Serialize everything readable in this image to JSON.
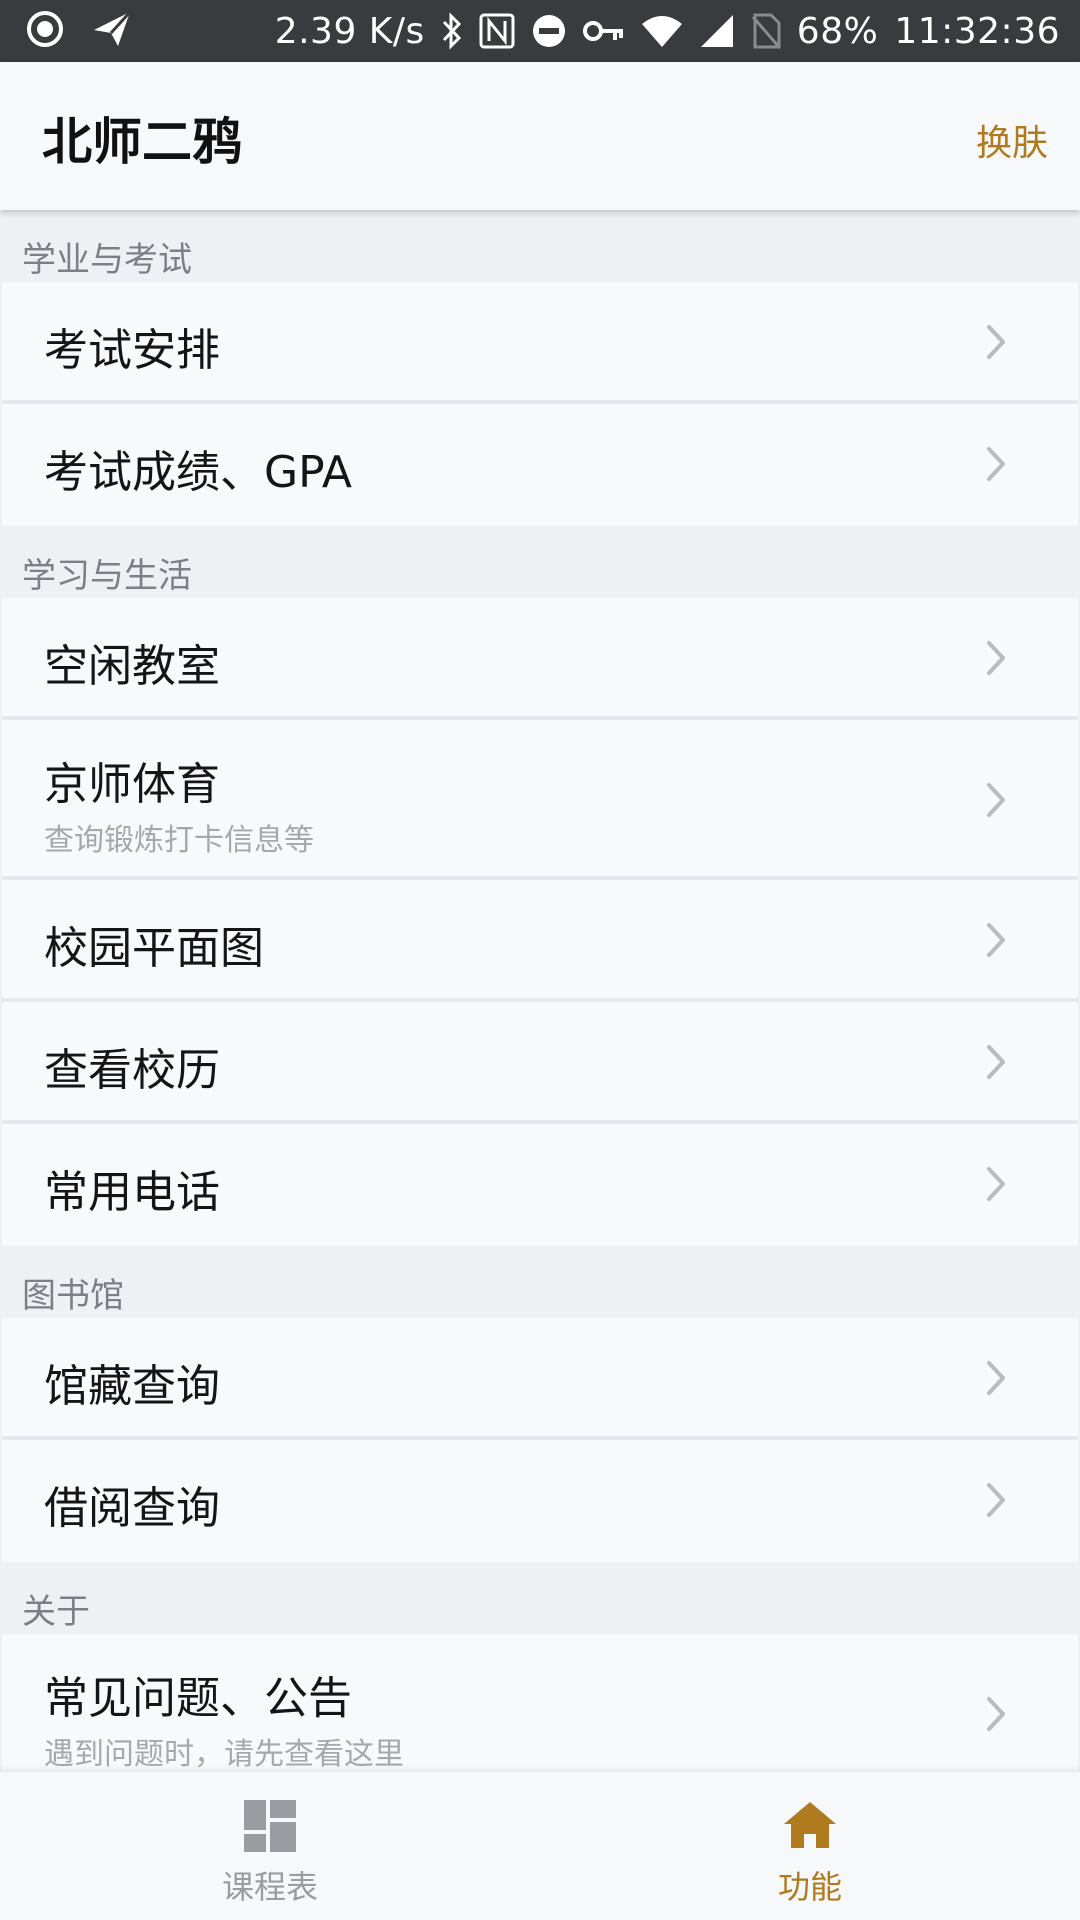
{
  "status_bar": {
    "speed": "2.39 K/s",
    "battery": "68%",
    "time": "11:32:36",
    "icons": [
      "record-icon",
      "send-icon",
      "bluetooth-icon",
      "nfc-icon",
      "dnd-icon",
      "vpn-key-icon",
      "wifi-icon",
      "cell-signal-icon",
      "no-sim-icon"
    ]
  },
  "header": {
    "title": "北师二鸦",
    "action": "换肤"
  },
  "sections": [
    {
      "title": "学业与考试",
      "items": [
        {
          "title": "考试安排",
          "subtitle": ""
        },
        {
          "title": "考试成绩、GPA",
          "subtitle": ""
        }
      ]
    },
    {
      "title": "学习与生活",
      "items": [
        {
          "title": "空闲教室",
          "subtitle": ""
        },
        {
          "title": "京师体育",
          "subtitle": "查询锻炼打卡信息等"
        },
        {
          "title": "校园平面图",
          "subtitle": ""
        },
        {
          "title": "查看校历",
          "subtitle": ""
        },
        {
          "title": "常用电话",
          "subtitle": ""
        }
      ]
    },
    {
      "title": "图书馆",
      "items": [
        {
          "title": "馆藏查询",
          "subtitle": ""
        },
        {
          "title": "借阅查询",
          "subtitle": ""
        }
      ]
    },
    {
      "title": "关于",
      "items": [
        {
          "title": "常见问题、公告",
          "subtitle": "遇到问题时，请先查看这里"
        }
      ]
    }
  ],
  "tabs": [
    {
      "label": "课程表",
      "icon": "dashboard-icon",
      "active": false
    },
    {
      "label": "功能",
      "icon": "home-icon",
      "active": true
    }
  ],
  "colors": {
    "accent": "#b07a1e",
    "status_bar_bg": "#3a3b3e",
    "section_bg": "#eef0f4",
    "item_bg": "#f8f9fb",
    "inactive_tab": "#9a9ca1"
  }
}
